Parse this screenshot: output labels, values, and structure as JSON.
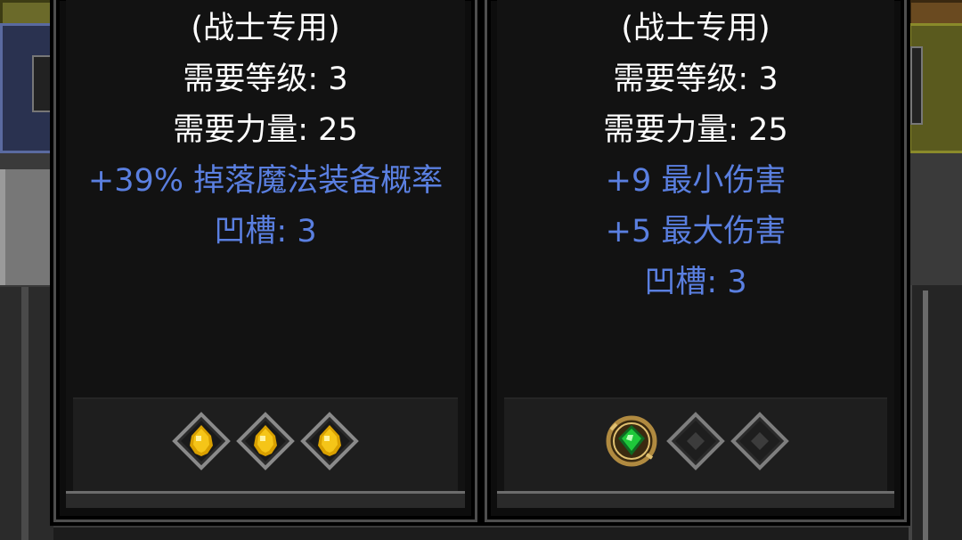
{
  "tooltips": [
    {
      "lines": [
        {
          "text": "(战士专用)",
          "color": "white"
        },
        {
          "text": "需要等级: 3",
          "color": "white"
        },
        {
          "text": "需要力量: 25",
          "color": "white"
        },
        {
          "text": "+39% 掉落魔法装备概率",
          "color": "blue"
        },
        {
          "text": "凹槽: 3",
          "color": "blue"
        }
      ],
      "sockets": [
        "gold-gem",
        "gold-gem",
        "gold-gem"
      ]
    },
    {
      "lines": [
        {
          "text": "(战士专用)",
          "color": "white"
        },
        {
          "text": "需要等级: 3",
          "color": "white"
        },
        {
          "text": "需要力量: 25",
          "color": "white"
        },
        {
          "text": "+9 最小伤害",
          "color": "blue"
        },
        {
          "text": "+5 最大伤害",
          "color": "blue"
        },
        {
          "text": "凹槽: 3",
          "color": "blue"
        }
      ],
      "sockets": [
        "emerald-gem",
        "empty",
        "empty"
      ]
    }
  ],
  "colors": {
    "white_text": "#ffffff",
    "blue_text": "#5a7fe0",
    "panel_bg": "#121212",
    "socket_bar_bg": "#1e1e1e"
  }
}
